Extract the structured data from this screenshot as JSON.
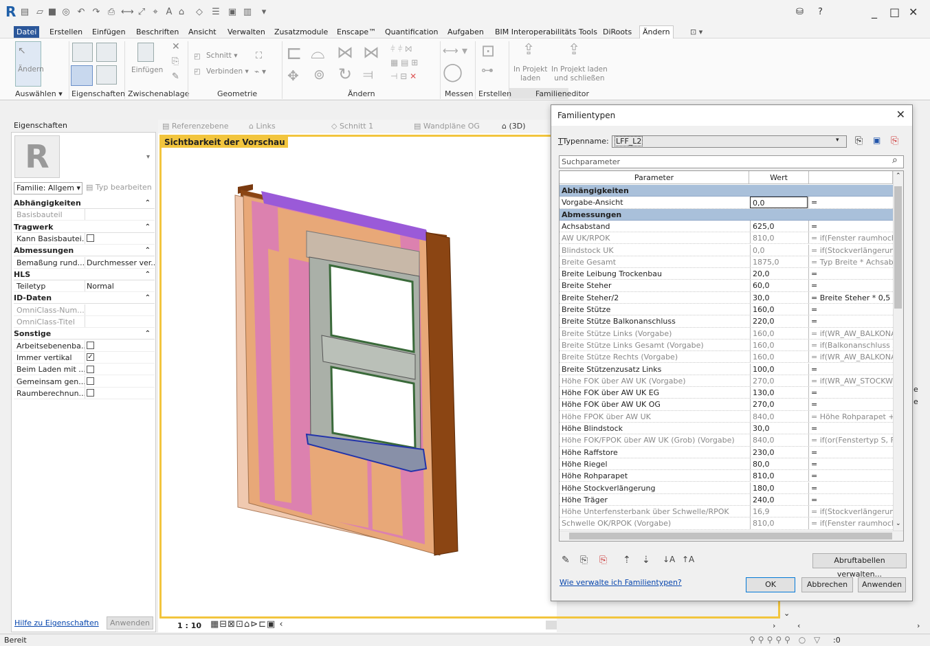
{
  "menu": [
    "Datei",
    "Erstellen",
    "Einfügen",
    "Beschriften",
    "Ansicht",
    "Verwalten",
    "Zusatzmodule",
    "Enscape™",
    "Quantification",
    "Aufgaben",
    "BIM Interoperabilitäts Tools",
    "DiRoots",
    "Ändern"
  ],
  "ribbon": {
    "aendern_btn": "Ändern",
    "einfuegen": "Einfügen",
    "schnitt": "Schnitt",
    "verbinden": "Verbinden",
    "in_projekt_laden": "In Projekt\nladen",
    "in_projekt_laden_l1": "In Projekt",
    "in_projekt_laden_l2": "laden",
    "laden_schliessen_l1": "In Projekt laden",
    "laden_schliessen_l2": "und schließen",
    "groups": [
      "Auswählen ▾",
      "Eigenschaften",
      "Zwischenablage",
      "Geometrie",
      "Ändern",
      "Messen",
      "Erstellen",
      "Familieneditor"
    ]
  },
  "properties": {
    "title": "Eigenschaften",
    "family_selector": "Familie: Allgem",
    "edit_type": "Typ bearbeiten",
    "rows": [
      {
        "type": "head",
        "name": "Abhängigkeiten"
      },
      {
        "type": "row",
        "name": "Basisbauteil",
        "value": "",
        "gray": true
      },
      {
        "type": "head",
        "name": "Tragwerk"
      },
      {
        "type": "check",
        "name": "Kann Basisbautei...",
        "checked": false
      },
      {
        "type": "head",
        "name": "Abmessungen"
      },
      {
        "type": "row",
        "name": "Bemaßung rund...",
        "value": "Durchmesser ver..."
      },
      {
        "type": "head",
        "name": "HLS"
      },
      {
        "type": "row",
        "name": "Teiletyp",
        "value": "Normal"
      },
      {
        "type": "head",
        "name": "ID-Daten"
      },
      {
        "type": "row",
        "name": "OmniClass-Num...",
        "value": "",
        "gray": true
      },
      {
        "type": "row",
        "name": "OmniClass-Titel",
        "value": "",
        "gray": true
      },
      {
        "type": "head",
        "name": "Sonstige"
      },
      {
        "type": "check",
        "name": "Arbeitsebenenba...",
        "checked": false
      },
      {
        "type": "check",
        "name": "Immer vertikal",
        "checked": true
      },
      {
        "type": "check",
        "name": "Beim Laden mit ...",
        "checked": false
      },
      {
        "type": "check",
        "name": "Gemeinsam gen...",
        "checked": false
      },
      {
        "type": "check",
        "name": "Raumberechnun...",
        "checked": false
      }
    ],
    "help_link": "Hilfe zu Eigenschaften",
    "apply": "Anwenden"
  },
  "view_tabs": [
    "Referenzebene",
    "Links",
    "Schnitt 1",
    "Wandpläne OG",
    "(3D)"
  ],
  "view_label": "Sichtbarkeit der Vorschau",
  "scale": "1 : 10",
  "status": "Bereit",
  "status_filter": ":0",
  "dialog": {
    "title": "Familientypen",
    "typename_label": "Typenname:",
    "typename_value": "LFF_L2",
    "search_placeholder": "Suchparameter",
    "col_param": "Parameter",
    "col_value": "Wert",
    "rows": [
      {
        "g": true,
        "name": "Abhängigkeiten"
      },
      {
        "name": "Vorgabe-Ansicht",
        "value": "0,0",
        "formula": "="
      },
      {
        "g": true,
        "name": "Abmessungen"
      },
      {
        "name": "Achsabstand",
        "value": "625,0",
        "formula": "="
      },
      {
        "name": "AW UK/RPOK",
        "value": "810,0",
        "formula": "= if(Fenster raumhoch, (",
        "gray": true
      },
      {
        "name": "Blindstock UK",
        "value": "0,0",
        "formula": "= if(Stockverlängerung,",
        "gray": true
      },
      {
        "name": "Breite Gesamt",
        "value": "1875,0",
        "formula": "= Typ Breite * Achsabsta",
        "gray": true
      },
      {
        "name": "Breite Leibung Trockenbau",
        "value": "20,0",
        "formula": "="
      },
      {
        "name": "Breite Steher",
        "value": "60,0",
        "formula": "="
      },
      {
        "name": "Breite Steher/2",
        "value": "30,0",
        "formula": "= Breite Steher * 0,5"
      },
      {
        "name": "Breite Stütze",
        "value": "160,0",
        "formula": "="
      },
      {
        "name": "Breite Stütze Balkonanschluss",
        "value": "220,0",
        "formula": "="
      },
      {
        "name": "Breite Stütze Links (Vorgabe)",
        "value": "160,0",
        "formula": "= if(WR_AW_BALKONAI",
        "gray": true
      },
      {
        "name": "Breite Stütze Links Gesamt (Vorgabe)",
        "value": "160,0",
        "formula": "= if(Balkonanschluss Zu",
        "gray": true
      },
      {
        "name": "Breite Stütze Rechts (Vorgabe)",
        "value": "160,0",
        "formula": "= if(WR_AW_BALKONAI",
        "gray": true
      },
      {
        "name": "Breite Stützenzusatz Links",
        "value": "100,0",
        "formula": "="
      },
      {
        "name": "Höhe FOK über AW UK (Vorgabe)",
        "value": "270,0",
        "formula": "= if(WR_AW_STOCKWEF",
        "gray": true
      },
      {
        "name": "Höhe FOK über AW UK EG",
        "value": "130,0",
        "formula": "="
      },
      {
        "name": "Höhe FOK über AW UK OG",
        "value": "270,0",
        "formula": "="
      },
      {
        "name": "Höhe FPOK über AW UK",
        "value": "840,0",
        "formula": "= Höhe Rohparapet + H",
        "gray": true
      },
      {
        "name": "Höhe Blindstock",
        "value": "30,0",
        "formula": "="
      },
      {
        "name": "Höhe FOK/FPOK über AW UK (Grob) (Vorgabe)",
        "value": "840,0",
        "formula": "= if(or(Fenstertyp S, Fen",
        "gray": true
      },
      {
        "name": "Höhe Raffstore",
        "value": "230,0",
        "formula": "="
      },
      {
        "name": "Höhe Riegel",
        "value": "80,0",
        "formula": "="
      },
      {
        "name": "Höhe Rohparapet",
        "value": "810,0",
        "formula": "="
      },
      {
        "name": "Höhe Stockverlängerung",
        "value": "180,0",
        "formula": "="
      },
      {
        "name": "Höhe Träger",
        "value": "240,0",
        "formula": "="
      },
      {
        "name": "Höhe Unterfensterbank über Schwelle/RPOK",
        "value": "16,9",
        "formula": "= if(Stockverlängerung,",
        "gray": true
      },
      {
        "name": "Schwelle OK/RPOK (Vorgabe)",
        "value": "810,0",
        "formula": "= if(Fenster raumhoch. \\",
        "gray": true
      }
    ],
    "manage_lookup": "Abruftabellen verwalten...",
    "help_link": "Wie verwalte ich Familientypen?",
    "ok": "OK",
    "cancel": "Abbrechen",
    "apply": "Anwenden"
  },
  "right_partial": [
    "le",
    "le"
  ]
}
